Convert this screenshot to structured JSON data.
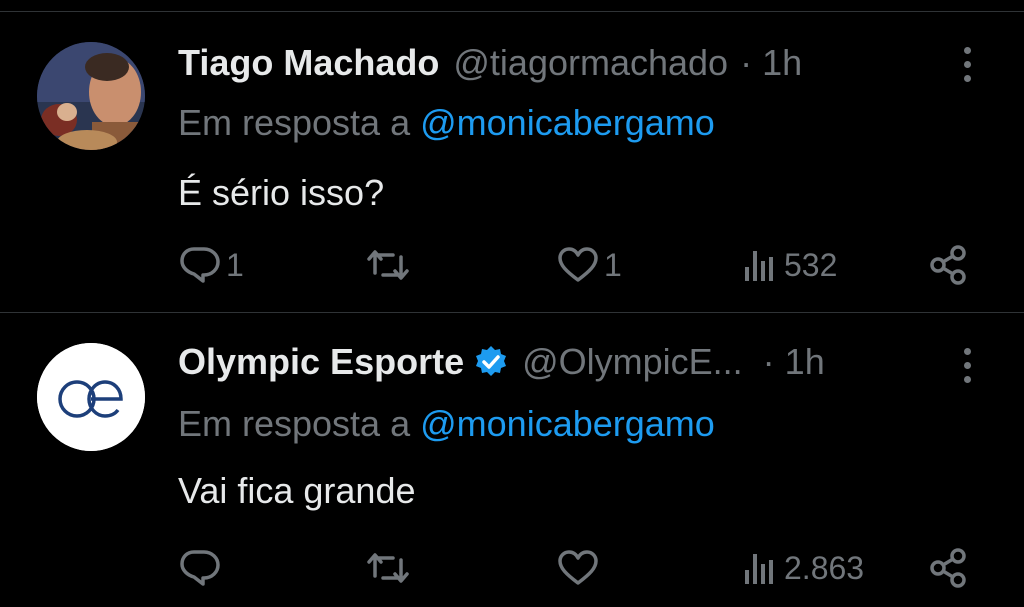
{
  "tweets": [
    {
      "name": "Tiago Machado",
      "handle": "@tiagormachado",
      "separator": "·",
      "time": "1h",
      "reply_prefix": "Em resposta a",
      "reply_mention": "@monicabergamo",
      "text": "É sério isso?",
      "replies": "1",
      "reposts": "",
      "likes": "1",
      "views": "532",
      "verified": false,
      "avatar_icon": "person-photo-avatar"
    },
    {
      "name": "Olympic Esporte",
      "handle": "@OlympicE...",
      "separator": "·",
      "time": "1h",
      "reply_prefix": "Em resposta a",
      "reply_mention": "@monicabergamo",
      "text": "Vai fica grande",
      "replies": "",
      "reposts": "",
      "likes": "",
      "views": "2.863",
      "verified": true,
      "avatar_icon": "oe-logo-avatar"
    }
  ],
  "colors": {
    "background": "#000000",
    "text": "#e7e9ea",
    "muted": "#71767b",
    "accent": "#1d9bf0",
    "divider": "#2f3336",
    "logo_blue": "#1d3f7a"
  },
  "icons": [
    "reply-icon",
    "repost-icon",
    "like-icon",
    "views-icon",
    "share-icon",
    "more-options-icon",
    "verified-badge-icon"
  ]
}
